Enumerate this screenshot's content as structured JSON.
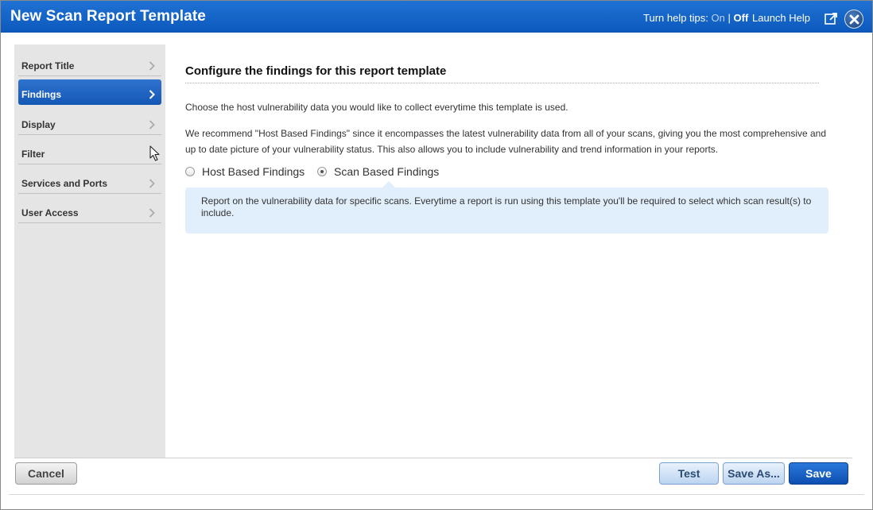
{
  "window": {
    "title": "New Scan Report Template"
  },
  "header": {
    "help_tips_label": "Turn help tips:",
    "help_on": "On",
    "help_separator": "|",
    "help_off": "Off",
    "launch_help": "Launch Help"
  },
  "sidebar": {
    "items": [
      {
        "label": "Report Title",
        "active": false
      },
      {
        "label": "Findings",
        "active": true
      },
      {
        "label": "Display",
        "active": false
      },
      {
        "label": "Filter",
        "active": false
      },
      {
        "label": "Services and Ports",
        "active": false
      },
      {
        "label": "User Access",
        "active": false
      }
    ]
  },
  "main": {
    "heading": "Configure the findings for this report template",
    "intro": "Choose the host vulnerability data you would like to collect everytime this template is used.",
    "recommendation": "We recommend \"Host Based Findings\" since it encompasses the latest vulnerability data from all of your scans, giving you the most comprehensive and up to date picture of your vulnerability status. This also allows you to include vulnerability and trend information in your reports.",
    "options": [
      {
        "label": "Host Based Findings",
        "checked": false
      },
      {
        "label": "Scan Based Findings",
        "checked": true
      }
    ],
    "info": "Report on the vulnerability data for specific scans. Everytime a report is run using this template you'll be required to select which scan result(s) to include."
  },
  "footer": {
    "cancel": "Cancel",
    "test": "Test",
    "save_as": "Save As...",
    "save": "Save"
  },
  "icons": {
    "popout": "popout-window-icon",
    "close": "close-icon",
    "chevron": "chevron-right-icon",
    "cursor": "mouse-pointer-icon"
  },
  "colors": {
    "titlebar": "#1565c8",
    "active_nav": "#1f63c2",
    "info_bg": "#e1eefb",
    "save_button": "#1a5fc4"
  }
}
